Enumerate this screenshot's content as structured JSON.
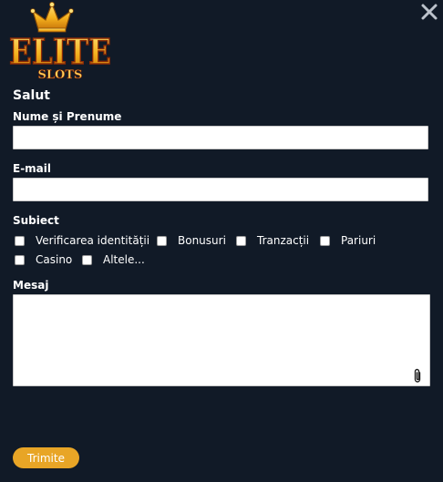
{
  "brand": {
    "logo_main": "ELITE",
    "logo_sub": "SLOTS"
  },
  "form": {
    "greeting": "Salut",
    "name_label": "Nume și Prenume",
    "name_value": "",
    "email_label": "E-mail",
    "email_value": "",
    "subject_label": "Subiect",
    "subject_options": [
      {
        "label": "Verificarea identității",
        "checked": false
      },
      {
        "label": "Bonusuri",
        "checked": false
      },
      {
        "label": "Tranzacții",
        "checked": false
      },
      {
        "label": "Pariuri",
        "checked": false
      },
      {
        "label": "Casino",
        "checked": false
      },
      {
        "label": "Altele...",
        "checked": false
      }
    ],
    "message_label": "Mesaj",
    "message_value": "",
    "submit_label": "Trimite"
  },
  "icons": {
    "close": "close-icon",
    "attach": "paperclip-icon",
    "logo_crown": "crown-icon"
  },
  "colors": {
    "background": "#111a27",
    "accent": "#e8a526",
    "logo_gold": "#f5b21f",
    "text": "#ffffff",
    "close_icon": "#bcc2cb"
  }
}
